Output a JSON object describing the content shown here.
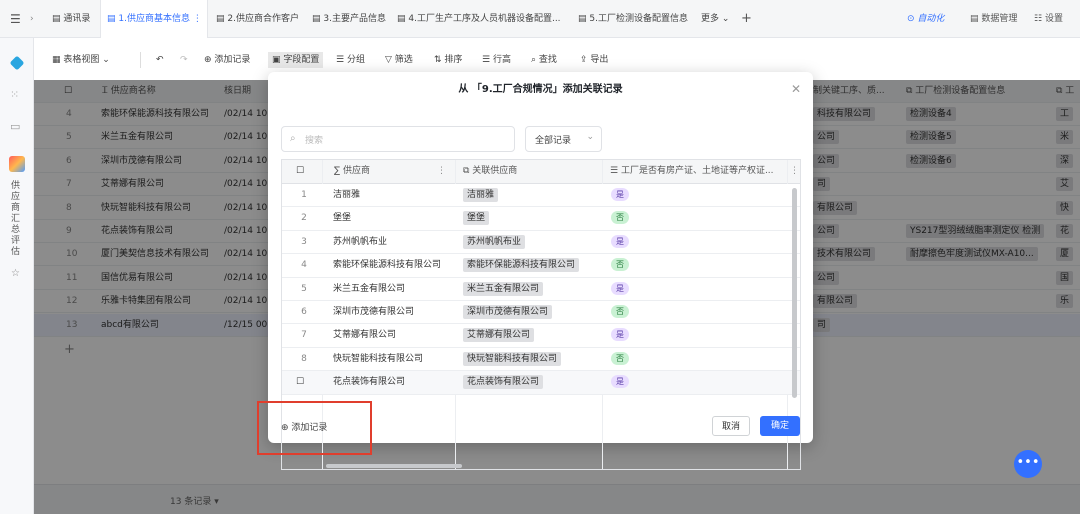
{
  "tabs": [
    {
      "label": "通讯录"
    },
    {
      "label": "1.供应商基本信息"
    },
    {
      "label": "2.供应商合作客户"
    },
    {
      "label": "3.主要产品信息"
    },
    {
      "label": "4.工厂生产工序及人员机器设备配置..."
    },
    {
      "label": "5.工厂检测设备配置信息"
    }
  ],
  "tabbar": {
    "more": "更多",
    "automation": "自动化",
    "data_mgmt": "数据管理",
    "settings": "设置"
  },
  "rail": {
    "app_label": "供应商汇总评估"
  },
  "toolbar": {
    "view": "表格视图",
    "add_record": "添加记录",
    "field_config": "字段配置",
    "group": "分组",
    "filter": "筛选",
    "sort": "排序",
    "row_height": "行高",
    "find": "查找",
    "export": "导出"
  },
  "grid": {
    "headers": {
      "name": "供应商名称",
      "date": "核日期",
      "process": "制关键工序、质...",
      "test": "工厂检测设备配置信息",
      "extra": "工"
    },
    "rows": [
      {
        "no": "4",
        "name": "索能环保能源科技有限公司",
        "date": "/02/14 10:",
        "process": "科技有限公司",
        "test": "检测设备4",
        "extra": "工"
      },
      {
        "no": "5",
        "name": "米兰五金有限公司",
        "date": "/02/14 10:",
        "process": "公司",
        "test": "检测设备5",
        "extra": "米"
      },
      {
        "no": "6",
        "name": "深圳市茂德有限公司",
        "date": "/02/14 10:",
        "process": "公司",
        "test": "检测设备6",
        "extra": "深"
      },
      {
        "no": "7",
        "name": "艾蒂娜有限公司",
        "date": "/02/14 10:",
        "process": "司",
        "test": "",
        "extra": "艾"
      },
      {
        "no": "8",
        "name": "快玩智能科技有限公司",
        "date": "/02/14 10:",
        "process": "有限公司",
        "test": "",
        "extra": "快"
      },
      {
        "no": "9",
        "name": "花点装饰有限公司",
        "date": "/02/14 10:",
        "process": "公司",
        "test": "YS217型羽绒绒脂率测定仪 检测",
        "extra": "花"
      },
      {
        "no": "10",
        "name": "厦门美契信息技术有限公司",
        "date": "/02/14 10:",
        "process": "技术有限公司",
        "test": "耐摩擦色牢度测试仪MX-A10...",
        "extra": "厦"
      },
      {
        "no": "11",
        "name": "国信优易有限公司",
        "date": "/02/14 10:",
        "process": "公司",
        "test": "",
        "extra": "国"
      },
      {
        "no": "12",
        "name": "乐雅卡特集团有限公司",
        "date": "/02/14 10:",
        "process": "有限公司",
        "test": "",
        "extra": "乐"
      },
      {
        "no": "13",
        "name": "abcd有限公司",
        "date": "/12/15 00:",
        "process": "司",
        "test": "",
        "extra": ""
      }
    ],
    "add_row": "+",
    "record_count": "13 条记录"
  },
  "modal": {
    "title": "从 「9.工厂合规情况」添加关联记录",
    "search_placeholder": "搜索",
    "filter_value": "全部记录",
    "headers": {
      "supplier": "供应商",
      "linked": "关联供应商",
      "property": "工厂是否有房产证、土地证等产权证..."
    },
    "rows": [
      {
        "no": "1",
        "supplier": "洁丽雅",
        "linked": "洁丽雅",
        "flag": "是",
        "yes": true
      },
      {
        "no": "2",
        "supplier": "堡堡",
        "linked": "堡堡",
        "flag": "否",
        "yes": false
      },
      {
        "no": "3",
        "supplier": "苏州帆帆布业",
        "linked": "苏州帆帆布业",
        "flag": "是",
        "yes": true
      },
      {
        "no": "4",
        "supplier": "索能环保能源科技有限公司",
        "linked": "索能环保能源科技有限公司",
        "flag": "否",
        "yes": false
      },
      {
        "no": "5",
        "supplier": "米兰五金有限公司",
        "linked": "米兰五金有限公司",
        "flag": "是",
        "yes": true
      },
      {
        "no": "6",
        "supplier": "深圳市茂德有限公司",
        "linked": "深圳市茂德有限公司",
        "flag": "否",
        "yes": false
      },
      {
        "no": "7",
        "supplier": "艾蒂娜有限公司",
        "linked": "艾蒂娜有限公司",
        "flag": "是",
        "yes": true
      },
      {
        "no": "8",
        "supplier": "快玩智能科技有限公司",
        "linked": "快玩智能科技有限公司",
        "flag": "否",
        "yes": false
      },
      {
        "no": "",
        "supplier": "花点装饰有限公司",
        "linked": "花点装饰有限公司",
        "flag": "是",
        "yes": true
      }
    ],
    "add_record": "添加记录",
    "cancel": "取消",
    "confirm": "确定"
  },
  "colors": {
    "accent": "#3370ff",
    "highlight": "#e03e2d"
  }
}
